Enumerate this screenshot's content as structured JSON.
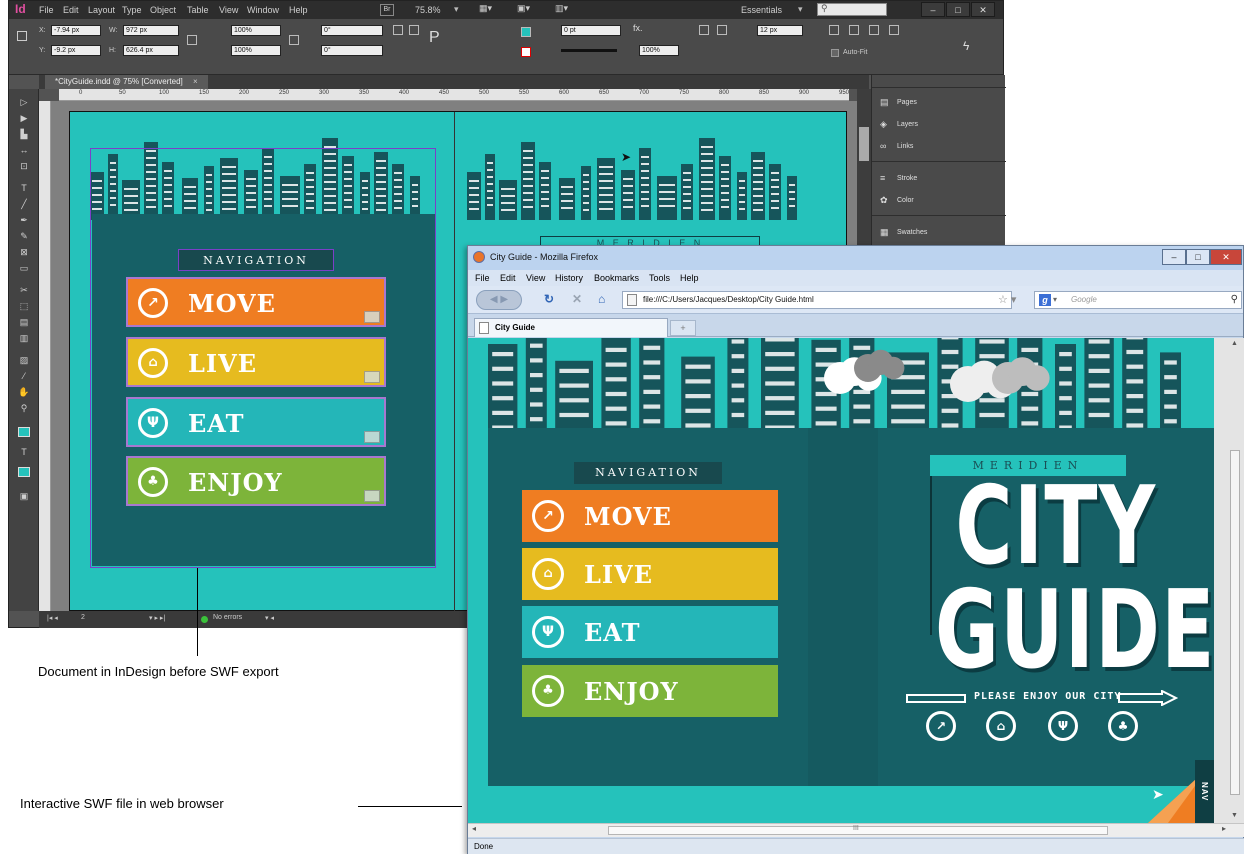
{
  "indesign": {
    "app_logo": "Id",
    "menus": [
      "File",
      "Edit",
      "Layout",
      "Type",
      "Object",
      "Table",
      "View",
      "Window",
      "Help"
    ],
    "bridge": "Br",
    "zoom": "75.8%",
    "workspace": "Essentials",
    "window_buttons": [
      "–",
      "□",
      "✕"
    ],
    "control": {
      "x": "-7.94 px",
      "y": "-9.2 px",
      "w": "972 px",
      "h": "626.4 px",
      "scale_x": "100%",
      "scale_y": "100%",
      "angle": "0°",
      "shear": "0°",
      "stroke_weight": "0 pt",
      "opacity": "100%",
      "columns": "12 px",
      "auto_fit": "Auto-Fit"
    },
    "doc_tab": "*CityGuide.indd @ 75% [Converted]",
    "doc_tab_close": "×",
    "ruler_ticks": [
      "0",
      "50",
      "100",
      "150",
      "200",
      "250",
      "300",
      "350",
      "400",
      "450",
      "500",
      "550",
      "600",
      "650",
      "700",
      "750",
      "800",
      "850",
      "900",
      "950"
    ],
    "status": {
      "page": "2",
      "preflight": "No errors"
    },
    "panels": [
      "Pages",
      "Layers",
      "Links",
      "Stroke",
      "Color",
      "Swatches"
    ],
    "panel_icons": [
      "pages-icon",
      "layers-icon",
      "links-icon",
      "stroke-icon",
      "color-icon",
      "swatches-icon"
    ],
    "page": {
      "nav_title": "NAVIGATION",
      "nav_buttons": [
        "MOVE",
        "LIVE",
        "EAT",
        "ENJOY"
      ],
      "meridien_partial": "M E R I D I E N"
    }
  },
  "firefox": {
    "title": "City Guide - Mozilla Firefox",
    "menus": [
      "File",
      "Edit",
      "View",
      "History",
      "Bookmarks",
      "Tools",
      "Help"
    ],
    "url": "file:///C:/Users/Jacques/Desktop/City Guide.html",
    "search_placeholder": "Google",
    "tab_title": "City Guide",
    "new_tab": "+",
    "status": "Done",
    "hscroll_mark": "III",
    "page": {
      "nav_title": "NAVIGATION",
      "nav_buttons": [
        "MOVE",
        "LIVE",
        "EAT",
        "ENJOY"
      ],
      "banner": "MERIDIEN",
      "headline_1": "CITY",
      "headline_2": "GUIDE",
      "tagline": "PLEASE ENJOY OUR CITY",
      "nav_tab": "NAV"
    }
  },
  "captions": {
    "indesign": "Document in InDesign before SWF export",
    "browser": "Interactive SWF file in web browser"
  },
  "colors": {
    "teal": "#25c2bb",
    "dark_teal": "#166066",
    "move": "#ef7d22",
    "live": "#e6bb1f",
    "eat": "#24b6b8",
    "enjoy": "#7db43a"
  }
}
